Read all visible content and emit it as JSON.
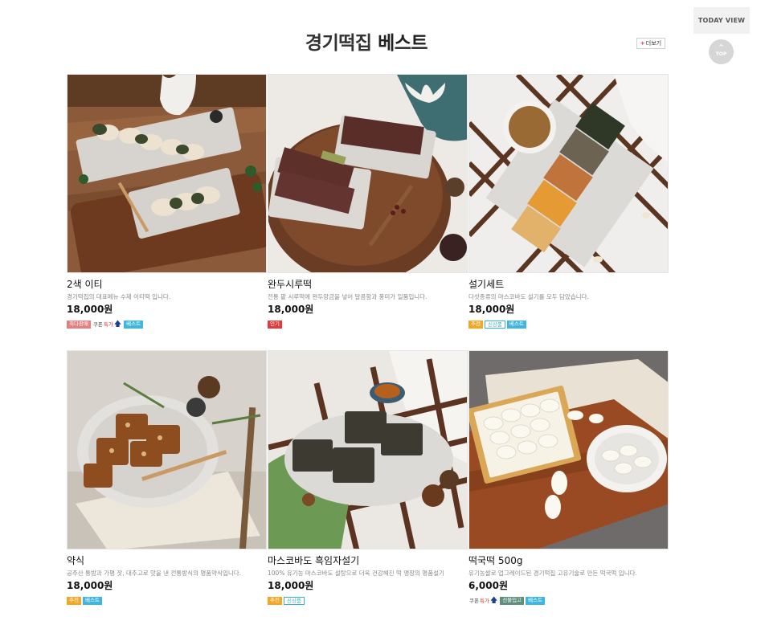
{
  "section": {
    "title_normal": "경기떡집 ",
    "title_bold": "베스트",
    "more_label": "더보기"
  },
  "quick": {
    "today_view": "TODAY VIEW",
    "top_label": "TOP"
  },
  "products": [
    {
      "name": "2색 이티",
      "desc": "경기떡집의 대표메뉴 수제 이티떡 입니다.",
      "price": "18,000원",
      "badges": [
        {
          "type": "solid",
          "label": "최다판매",
          "color": "#e57f7f"
        },
        {
          "type": "coupon",
          "label_a": "쿠폰",
          "label_b": "특가"
        },
        {
          "type": "solid",
          "label": "베스트",
          "color": "#3fb6e0"
        }
      ]
    },
    {
      "name": "완두시루떡",
      "desc": "전통 팥 시루떡에 완두앙금을 넣어 달콤함과 풍미가 일품입니다.",
      "price": "18,000원",
      "badges": [
        {
          "type": "solid",
          "label": "인기",
          "color": "#e23b3b"
        }
      ]
    },
    {
      "name": "설기세트",
      "desc": "다섯종류의 마스코바도 설기를 모두 담았습니다.",
      "price": "18,000원",
      "badges": [
        {
          "type": "solid",
          "label": "추천",
          "color": "#f5a623"
        },
        {
          "type": "outline",
          "label": "신상품"
        },
        {
          "type": "solid",
          "label": "베스트",
          "color": "#3fb6e0"
        }
      ]
    },
    {
      "name": "약식",
      "desc": "공주산 통밤과 가평 잣, 대추고로 맛을 낸 전통방식의 명품약식입니다.",
      "price": "18,000원",
      "badges": [
        {
          "type": "solid",
          "label": "추천",
          "color": "#f5a623"
        },
        {
          "type": "solid",
          "label": "베스트",
          "color": "#3fb6e0"
        }
      ]
    },
    {
      "name": "마스코바도 흑임자설기",
      "desc": "100% 유기농 마스코바도 설탕으로 더욱 건강해진 떡 맹장의 명품설기",
      "price": "18,000원",
      "badges": [
        {
          "type": "solid",
          "label": "추천",
          "color": "#f5a623"
        },
        {
          "type": "outline",
          "label": "신상품"
        }
      ]
    },
    {
      "name": "떡국떡 500g",
      "desc": "유기농쌀로 업그레이드된 경기떡집 고유기술로 만든 떡국떡 입니다.",
      "price": "6,000원",
      "badges": [
        {
          "type": "coupon",
          "label_a": "쿠폰",
          "label_b": "특가"
        },
        {
          "type": "solid",
          "label": "선물입고",
          "color": "#5e8f7d"
        },
        {
          "type": "solid",
          "label": "베스트",
          "color": "#3fb6e0"
        }
      ]
    }
  ],
  "colors": {
    "wood": "#8a4f2c",
    "bg_gray": "#e9e7e4"
  }
}
